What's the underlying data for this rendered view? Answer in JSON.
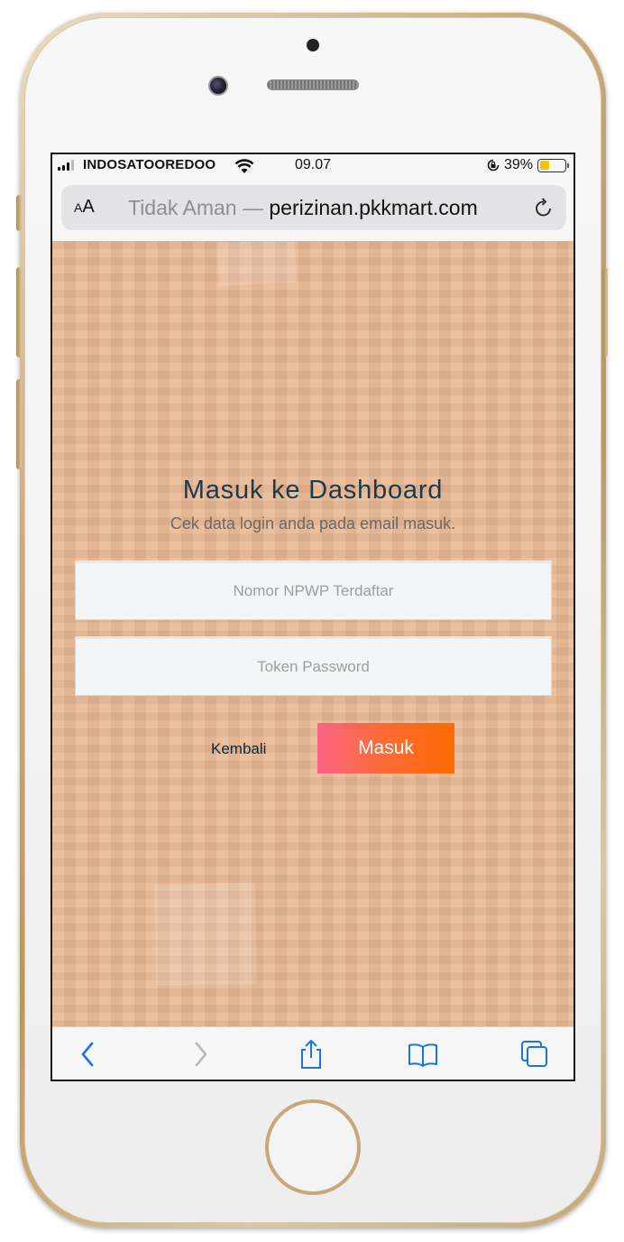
{
  "status_bar": {
    "carrier": "INDOSATOOREDOO",
    "time": "09.07",
    "battery_percent": "39%",
    "battery_level": 0.39,
    "signal_bars": 3,
    "icons": [
      "signal-icon",
      "wifi-icon",
      "orientation-lock-icon",
      "battery-icon"
    ]
  },
  "browser": {
    "text_size_button": "AA",
    "url_insecure_label": "Tidak Aman —",
    "url_domain": "perizinan.pkkmart.com",
    "icons": [
      "text-size-icon",
      "reload-icon"
    ]
  },
  "login": {
    "title": "Masuk ke Dashboard",
    "subtitle": "Cek data login anda pada email masuk.",
    "npwp_placeholder": "Nomor NPWP Terdaftar",
    "npwp_value": "",
    "token_placeholder": "Token Password",
    "token_value": "",
    "back_link": "Kembali",
    "submit_label": "Masuk"
  },
  "toolbar": {
    "icons": [
      "back-icon",
      "forward-icon",
      "share-icon",
      "bookmarks-icon",
      "tabs-icon"
    ]
  },
  "colors": {
    "background": "#e8b894",
    "title": "#1c3a4a",
    "button_gradient_start": "#fc6585",
    "button_gradient_end": "#ff6a00",
    "ios_blue": "#1a73e8",
    "battery": "#f4c400"
  }
}
